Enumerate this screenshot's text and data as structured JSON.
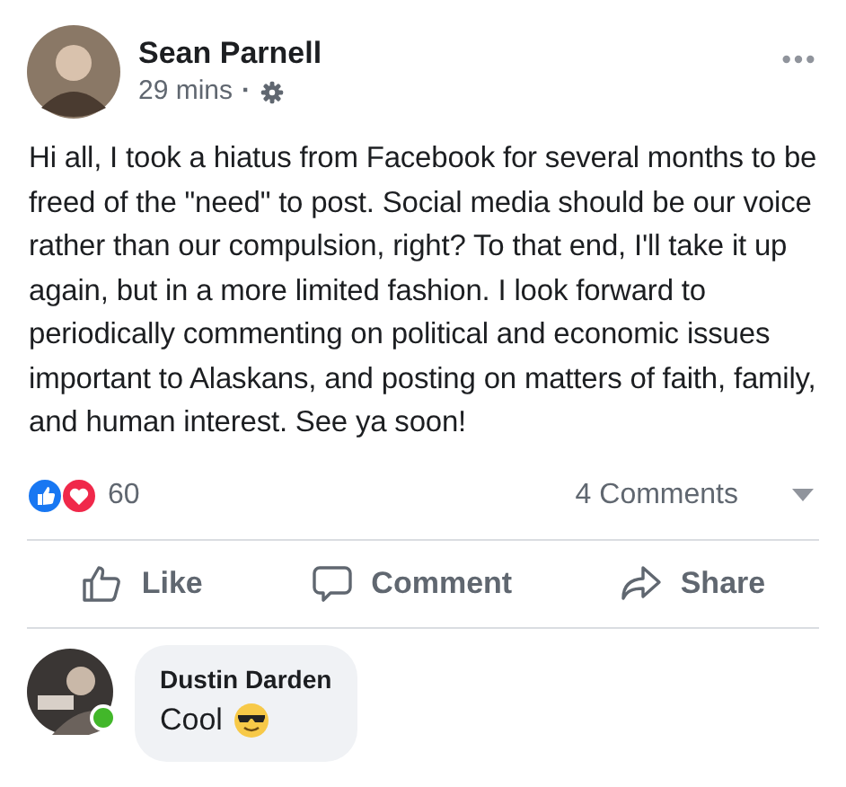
{
  "post": {
    "author": "Sean Parnell",
    "time": "29 mins",
    "separator": "·",
    "text": "Hi all, I took a hiatus from Facebook for several months to be freed of the \"need\" to post. Social media should be our voice rather than our compulsion, right? To that end, I'll take it up again, but in a more limited fashion. I look forward to periodically commenting on political and economic issues important to Alaskans, and posting on matters of faith, family, and human interest. See ya soon!"
  },
  "reactions": {
    "count": "60",
    "comments": "4 Comments"
  },
  "actions": [
    {
      "kind": "like",
      "label": "Like"
    },
    {
      "kind": "comment",
      "label": "Comment"
    },
    {
      "kind": "share",
      "label": "Share"
    }
  ],
  "comments": [
    {
      "author": "Dustin Darden",
      "text": "Cool",
      "online": true
    }
  ]
}
